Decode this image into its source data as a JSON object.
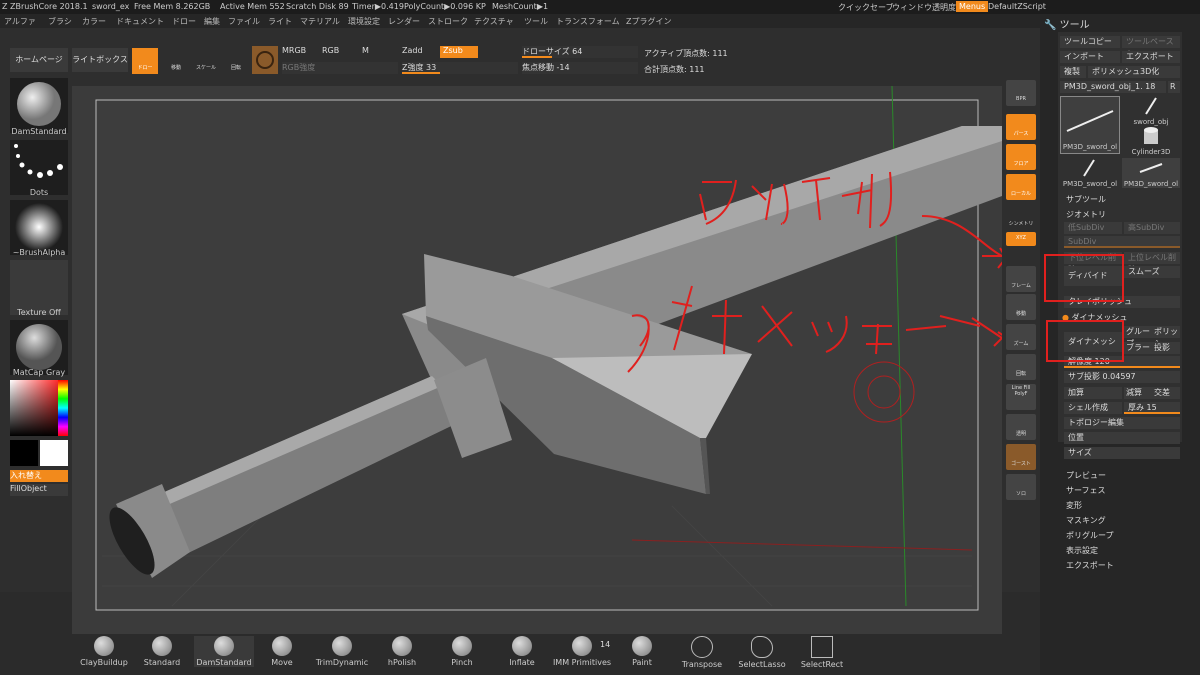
{
  "titlebar": {
    "app": "ZBrushCore 2018.1",
    "file": "sword_ex",
    "free_mem": "Free Mem 8.262GB",
    "active_mem": "Active Mem 552",
    "scratch_disk": "Scratch Disk 89",
    "timer": "Timer▶0.419",
    "polycount": "PolyCount▶0.096 KP",
    "meshcount": "MeshCount▶1",
    "quicksave": "クイックセーブ",
    "transparency": "ウィンドウ透明度",
    "menus": "Menus",
    "script": "DefaultZScript"
  },
  "menus": [
    "アルファ",
    "ブラシ",
    "カラー",
    "ドキュメント",
    "ドロー",
    "編集",
    "ファイル",
    "ライト",
    "マテリアル",
    "環境設定",
    "レンダー",
    "ストローク",
    "テクスチャ",
    "ツール",
    "トランスフォーム",
    "Zプラグイン"
  ],
  "topshelf": {
    "home": "ホームページ",
    "lightbox": "ライトボックス",
    "draw": "ドロー",
    "move": "移動",
    "scale": "スケール",
    "rotate": "回転",
    "mrgb": "MRGB",
    "rgb": "RGB",
    "m": "M",
    "zadd": "Zadd",
    "zsub": "Zsub",
    "rgb_intensity": "RGB強度",
    "z_intensity": "Z強度 33",
    "draw_size": "ドローサイズ 64",
    "focal_shift": "焦点移動 -14",
    "active_points": "アクティブ頂点数: 111",
    "total_points": "合計頂点数: 111",
    "z_intensity_value": 33,
    "draw_size_value": 64
  },
  "leftshelf": {
    "brush": "DamStandard",
    "stroke": "Dots",
    "alpha": "~BrushAlpha",
    "texture": "Texture Off",
    "material": "MatCap Gray",
    "swap": "入れ替え",
    "fill": "FillObject"
  },
  "rightshelf": [
    "BPR",
    "パース",
    "フロア",
    "ローカル",
    "シンメトリ",
    "XYZ",
    "",
    "フレーム",
    "移動",
    "ズーム",
    "回転",
    "Line Fill",
    "PolyF",
    "透明",
    "ゴースト",
    "ソロ"
  ],
  "annotations": {
    "divide_text": "ディバイド",
    "dynamesh_text": "ダイナメッシュ"
  },
  "panel": {
    "title": "ツール",
    "tool_copy": "ツールコピー",
    "tool_paste": "ツールペースト",
    "import": "インポート",
    "export": "エクスポート",
    "clone": "複製",
    "make_polymesh": "ポリメッシュ3D化",
    "current_tool": "PM3D_sword_obj_1. 18",
    "r": "R",
    "thumbs": [
      "PM3D_sword_ol",
      "sword_obj",
      "Cylinder3D",
      "PM3D_sword_ol",
      "PM3D_sword_ol"
    ],
    "subtool": "サブツール",
    "geometry": "ジオメトリ",
    "lower_subdiv": "低SubDiv",
    "higher_subdiv": "高SubDiv",
    "subdiv": "SubDiv",
    "del_lower": "下位レベル削除",
    "del_higher": "上位レベル削除",
    "divide": "ディバイド",
    "smooth": "スムーズ",
    "crease_polish": "クレイポリッシュ",
    "dynamesh_section": "ダイナメッシュ",
    "dynamesh_btn": "ダイナメッシュ",
    "groups": "グループ",
    "polish": "ポリッシ",
    "blur": "ブラー",
    "project": "投影",
    "resolution": "解像度 120",
    "subproject": "サブ投影 0.04597",
    "add": "加算",
    "subtract": "減算",
    "intersect": "交差",
    "shell": "シェル作成",
    "thickness": "厚み 15",
    "topology": "トポロジー編集",
    "position": "位置",
    "size": "サイズ",
    "preview": "プレビュー",
    "surface": "サーフェス",
    "deformation": "変形",
    "masking": "マスキング",
    "polygroups": "ポリグループ",
    "display": "表示設定",
    "export2": "エクスポート"
  },
  "bottombar": [
    "ClayBuildup",
    "Standard",
    "DamStandard",
    "Move",
    "TrimDynamic",
    "hPolish",
    "Pinch",
    "Inflate",
    "IMM Primitives",
    "Paint",
    "Transpose",
    "SelectLasso",
    "SelectRect"
  ],
  "imm_count": "14",
  "colors": {
    "accent": "#f28a1c",
    "annotation": "#e0201e",
    "panel": "#262626",
    "viewport": "#3b3b3b"
  }
}
